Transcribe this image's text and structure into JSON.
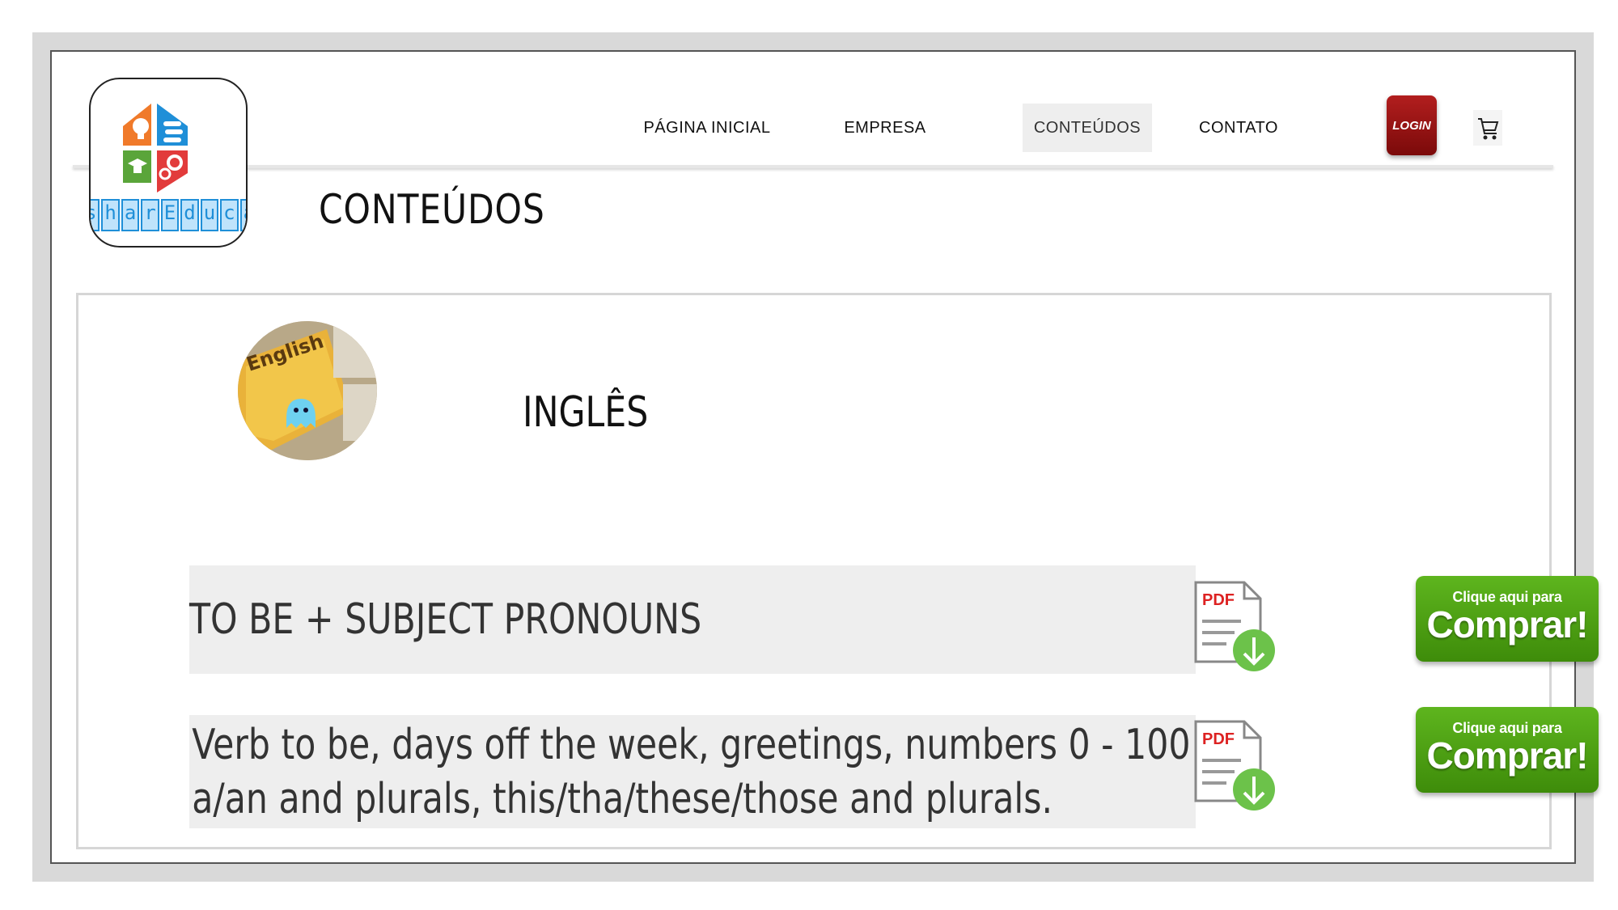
{
  "brand": {
    "logo_text": [
      "s",
      "h",
      "a",
      "r",
      "E",
      "d",
      "u",
      "c",
      "a"
    ]
  },
  "nav": {
    "items": [
      {
        "label": "PÁGINA INICIAL"
      },
      {
        "label": "EMPRESA"
      },
      {
        "label": "CONTEÚDOS",
        "active": true
      },
      {
        "label": "CONTATO"
      }
    ],
    "login_label": "LOGIN"
  },
  "page": {
    "title": "CONTEÚDOS"
  },
  "subject": {
    "name": "INGLÊS",
    "thumbnail_text": "English"
  },
  "lessons": [
    {
      "lines": [
        "TO BE + SUBJECT PRONOUNS"
      ],
      "pdf_label": "PDF",
      "buy_small": "Clique aqui para",
      "buy_big": "Comprar!"
    },
    {
      "lines": [
        "Verb to be, days off the week, greetings, numbers 0 - 100",
        "a/an and plurals, this/tha/these/those and plurals."
      ],
      "pdf_label": "PDF",
      "buy_small": "Clique aqui para",
      "buy_big": "Comprar!"
    }
  ],
  "colors": {
    "login_red": "#9b1414",
    "buy_green": "#4c9f12",
    "pdf_download_green": "#6cc24a",
    "lesson_bg": "#eeeeee"
  }
}
